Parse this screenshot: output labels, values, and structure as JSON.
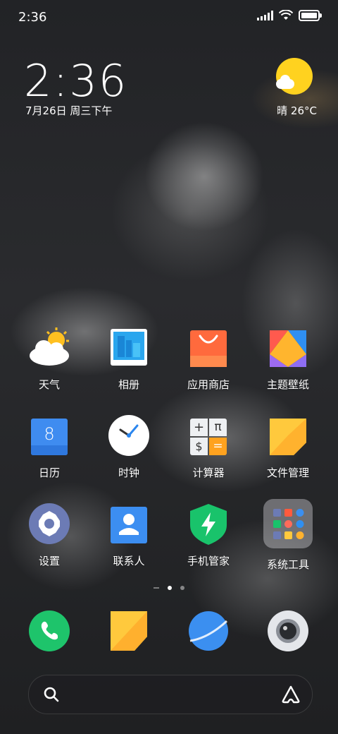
{
  "status_bar": {
    "time": "2:36"
  },
  "widget": {
    "clock": "2:36",
    "date": "7月26日 周三下午",
    "weather": "晴 26°C"
  },
  "apps": [
    {
      "label": "天气"
    },
    {
      "label": "相册"
    },
    {
      "label": "应用商店"
    },
    {
      "label": "主题壁纸"
    },
    {
      "label": "日历",
      "calendar_day": "8"
    },
    {
      "label": "时钟"
    },
    {
      "label": "计算器"
    },
    {
      "label": "文件管理"
    },
    {
      "label": "设置"
    },
    {
      "label": "联系人"
    },
    {
      "label": "手机管家"
    },
    {
      "label": "系统工具"
    }
  ],
  "calculator_symbols": {
    "plus": "+",
    "pi": "π",
    "dollar": "$",
    "equals": "="
  },
  "page_indicator": {
    "pages": 2,
    "current": 1
  },
  "dock": [
    {
      "name": "phone"
    },
    {
      "name": "messages"
    },
    {
      "name": "browser"
    },
    {
      "name": "camera"
    }
  ],
  "colors": {
    "sun": "#ffd21f",
    "phone": "#1ec46b",
    "calendar": "#3f8cf0",
    "contacts": "#3c8ef1",
    "security": "#19c36b",
    "browser": "#3b8ff0",
    "notes": "#ffc93d"
  }
}
